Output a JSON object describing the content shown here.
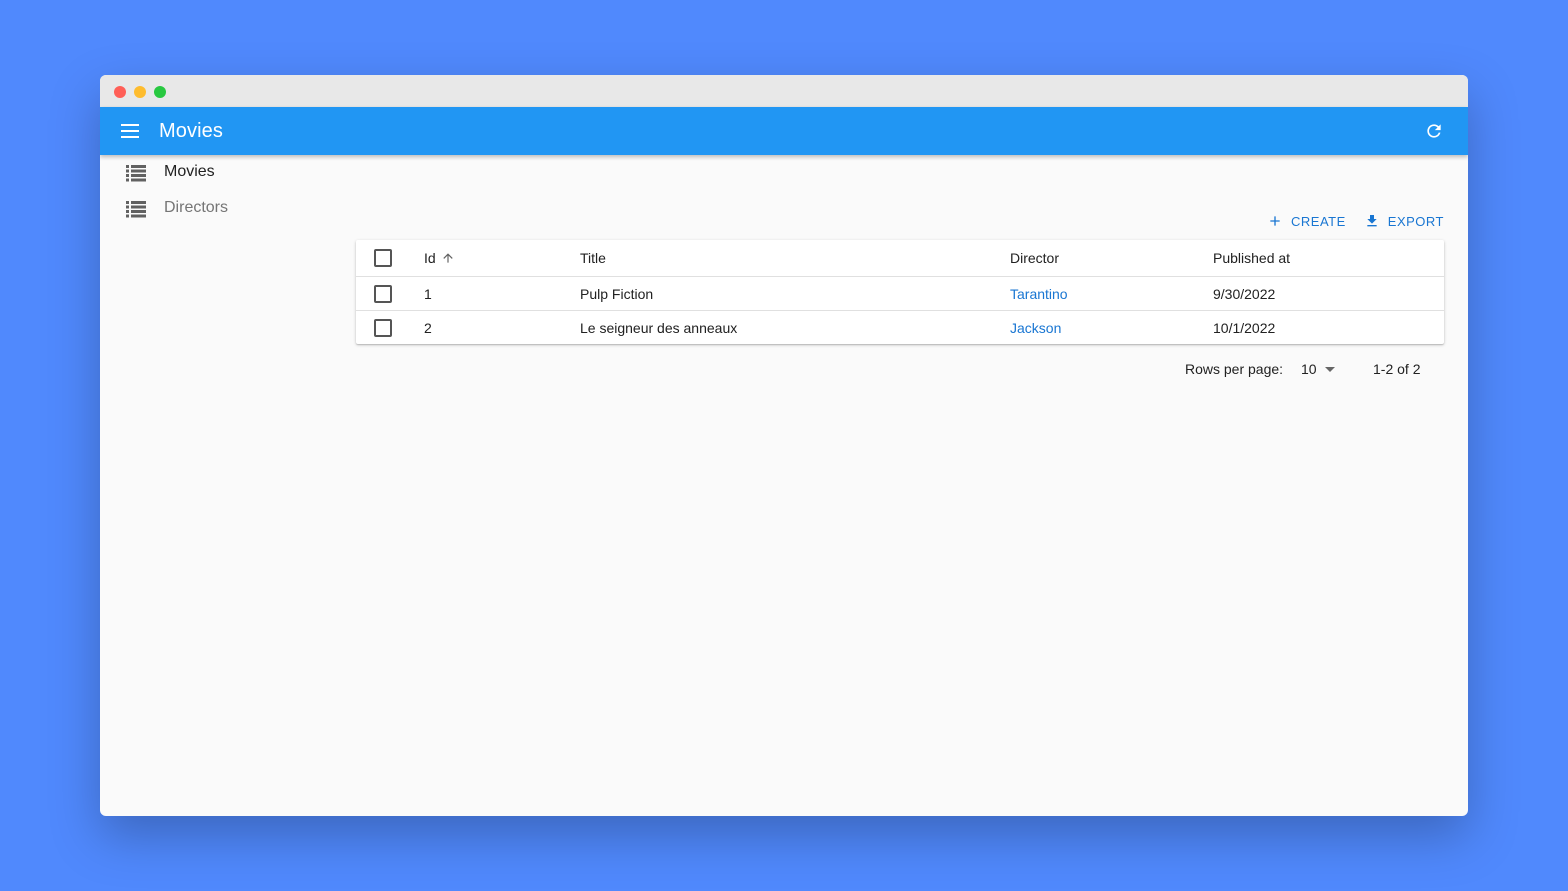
{
  "app": {
    "title": "Movies"
  },
  "toolbar": {
    "create_label": "CREATE",
    "export_label": "EXPORT"
  },
  "sidebar": {
    "items": [
      {
        "label": "Movies",
        "icon": "list-icon",
        "active": true
      },
      {
        "label": "Directors",
        "icon": "list-icon",
        "active": false
      }
    ]
  },
  "table": {
    "columns": [
      "Id",
      "Title",
      "Director",
      "Published at"
    ],
    "sort": {
      "column": "Id",
      "direction": "asc"
    },
    "rows": [
      {
        "id": "1",
        "title": "Pulp Fiction",
        "director": "Tarantino",
        "published_at": "9/30/2022"
      },
      {
        "id": "2",
        "title": "Le seigneur des anneaux",
        "director": "Jackson",
        "published_at": "10/1/2022"
      }
    ]
  },
  "pagination": {
    "rows_per_page_label": "Rows per page:",
    "rows_per_page_value": "10",
    "range_label": "1-2 of 2"
  },
  "colors": {
    "background": "#5089fd",
    "appbar": "#2196f3",
    "accent": "#1976d2"
  }
}
